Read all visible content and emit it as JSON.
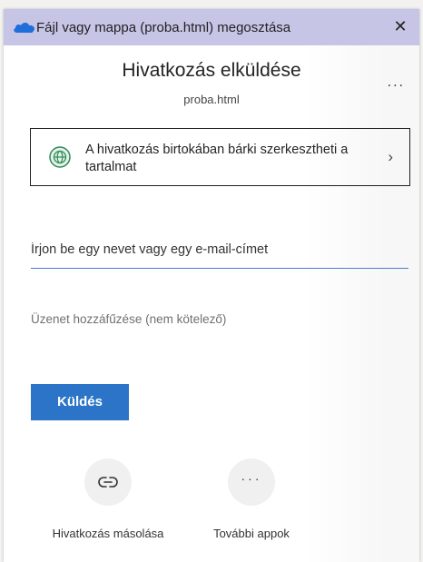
{
  "window": {
    "title": "Fájl vagy mappa (proba.html) megosztása",
    "close_symbol": "✕"
  },
  "panel": {
    "heading": "Hivatkozás elküldése",
    "filename": "proba.html",
    "more_symbol": "..."
  },
  "permission": {
    "text": "A hivatkozás birtokában bárki szerkesztheti a tartalmat",
    "chevron": "›"
  },
  "recipients": {
    "placeholder": "Írjon be egy nevet vagy egy e-mail-címet"
  },
  "message": {
    "placeholder": "Üzenet hozzáfűzése (nem kötelező)"
  },
  "send_button": {
    "label": "Küldés"
  },
  "actions": [
    {
      "label": "Hivatkozás másolása",
      "icon": "link-icon"
    },
    {
      "label": "További appok",
      "icon": "more-icon",
      "glyph": "···"
    }
  ],
  "colors": {
    "titlebar": "#c7c5e6",
    "accent": "#2b74c8",
    "globe": "#2e8b57"
  }
}
